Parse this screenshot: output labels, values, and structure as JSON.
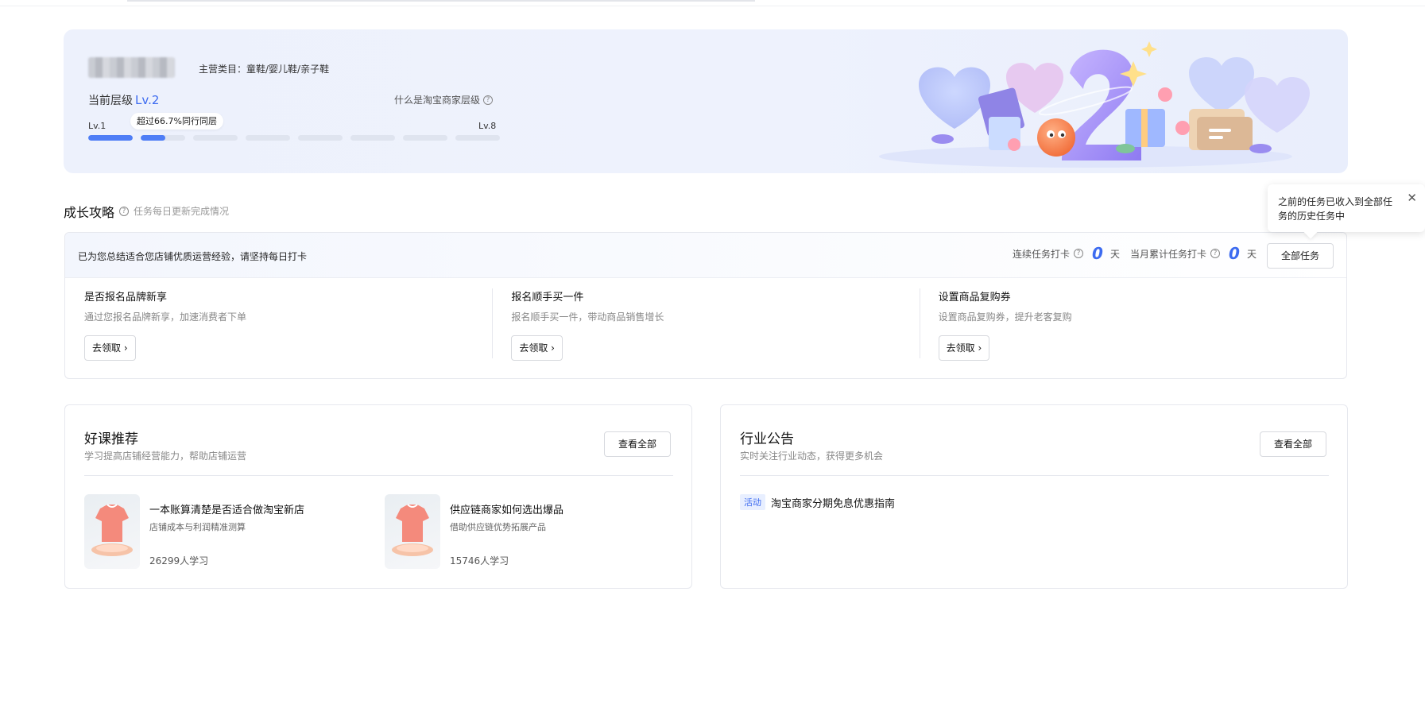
{
  "hero": {
    "category_label": "主营类目：童鞋/婴儿鞋/亲子鞋",
    "level_prefix": "当前层级",
    "level_value": "Lv.2",
    "what_is_level": "什么是淘宝商家层级",
    "level_start": "Lv.1",
    "level_end": "Lv.8",
    "progress_tip": "超过66.7%同行同层",
    "level_progress": {
      "current_level": 2,
      "total_levels": 8,
      "current_bar_fill_fraction": 0.55
    },
    "accent_color": "#3d6bf0"
  },
  "growth": {
    "title": "成长攻略",
    "subtitle": "任务每日更新完成情况",
    "intro": "已为您总结适合您店铺优质运营经验，请坚持每日打卡",
    "consecutive_label": "连续任务打卡",
    "consecutive_value": "0",
    "monthly_label": "当月累计任务打卡",
    "monthly_value": "0",
    "day_unit": "天",
    "all_tasks_button": "全部任务",
    "tasks": [
      {
        "name": "是否报名品牌新享",
        "desc": "通过您报名品牌新享，加速消费者下单",
        "button": "去领取"
      },
      {
        "name": "报名顺手买一件",
        "desc": "报名顺手买一件，带动商品销售增长",
        "button": "去领取"
      },
      {
        "name": "设置商品复购券",
        "desc": "设置商品复购券，提升老客复购",
        "button": "去领取"
      }
    ]
  },
  "tooltip": {
    "text": "之前的任务已收入到全部任务的历史任务中"
  },
  "courses": {
    "title": "好课推荐",
    "subtitle": "学习提高店铺经营能力，帮助店铺运营",
    "view_all": "查看全部",
    "items": [
      {
        "title": "一本账算清楚是否适合做淘宝新店",
        "desc": "店铺成本与利润精准测算",
        "count": "26299人学习"
      },
      {
        "title": "供应链商家如何选出爆品",
        "desc": "借助供应链优势拓展产品",
        "count": "15746人学习"
      }
    ]
  },
  "announcements": {
    "title": "行业公告",
    "subtitle": "实时关注行业动态，获得更多机会",
    "view_all": "查看全部",
    "items": [
      {
        "tag": "活动",
        "text": "淘宝商家分期免息优惠指南"
      }
    ]
  }
}
